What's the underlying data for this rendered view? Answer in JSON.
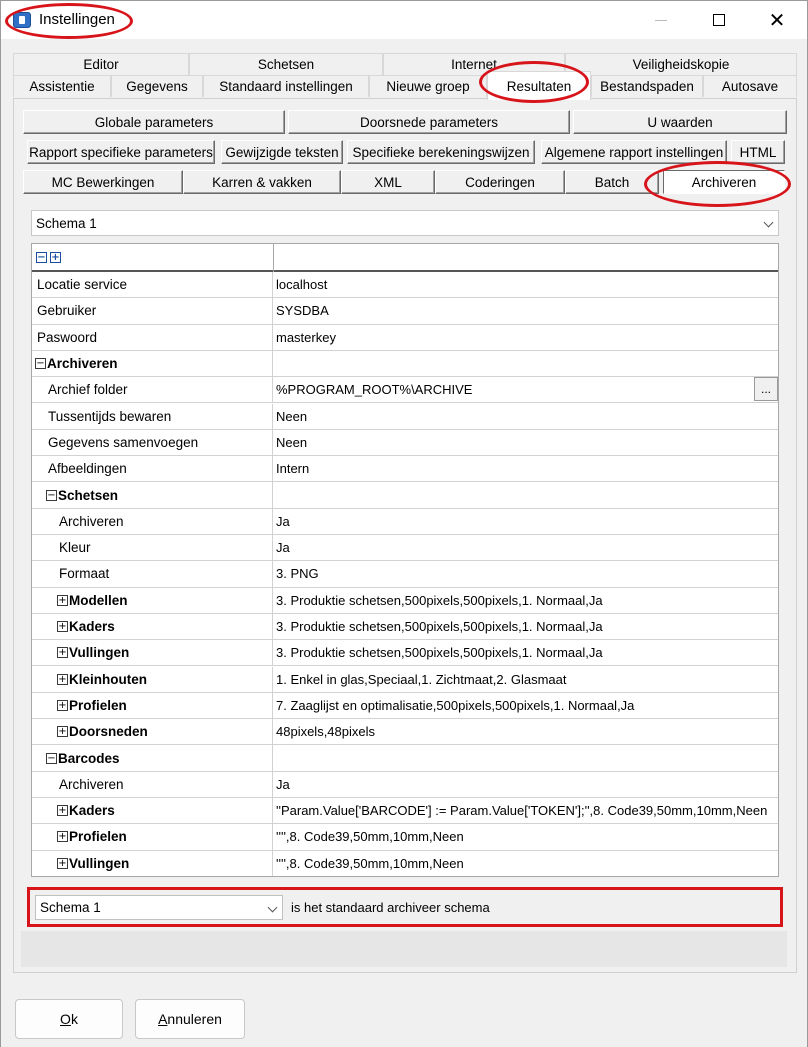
{
  "window": {
    "title": "Instellingen"
  },
  "tabs": {
    "back_row": [
      "Editor",
      "Schetsen",
      "Internet",
      "Veiligheidskopie"
    ],
    "front_row": [
      "Assistentie",
      "Gegevens",
      "Standaard instellingen",
      "Nieuwe groep",
      "Resultaten",
      "Bestandspaden",
      "Autosave"
    ],
    "active": "Resultaten"
  },
  "subtabs": {
    "row1": [
      "Globale parameters",
      "Doorsnede parameters",
      "U waarden"
    ],
    "row2": [
      "Rapport specifieke parameters",
      "Gewijzigde teksten",
      "Specifieke berekeningswijzen",
      "Algemene rapport instellingen",
      "HTML"
    ],
    "row3": [
      "MC Bewerkingen",
      "Karren & vakken",
      "XML",
      "Coderingen",
      "Batch",
      "Archiveren"
    ],
    "active": "Archiveren"
  },
  "schema_select": {
    "value": "Schema 1"
  },
  "grid": {
    "rows": [
      {
        "label": "Locatie service",
        "value": "localhost",
        "indent": 0,
        "expander": "",
        "bold": false
      },
      {
        "label": "Gebruiker",
        "value": "SYSDBA",
        "indent": 0,
        "expander": "",
        "bold": false
      },
      {
        "label": "Paswoord",
        "value": "masterkey",
        "indent": 0,
        "expander": "",
        "bold": false
      },
      {
        "label": "Archiveren",
        "value": "",
        "indent": 0,
        "expander": "−",
        "bold": true
      },
      {
        "label": "Archief folder",
        "value": "%PROGRAM_ROOT%\\ARCHIVE",
        "indent": 1,
        "expander": "",
        "bold": false,
        "ellipsis": "..."
      },
      {
        "label": "Tussentijds bewaren",
        "value": "Neen",
        "indent": 1,
        "expander": "",
        "bold": false
      },
      {
        "label": "Gegevens samenvoegen",
        "value": "Neen",
        "indent": 1,
        "expander": "",
        "bold": false
      },
      {
        "label": "Afbeeldingen",
        "value": "Intern",
        "indent": 1,
        "expander": "",
        "bold": false
      },
      {
        "label": "Schetsen",
        "value": "",
        "indent": 1,
        "expander": "−",
        "bold": true
      },
      {
        "label": "Archiveren",
        "value": "Ja",
        "indent": 2,
        "expander": "",
        "bold": false
      },
      {
        "label": "Kleur",
        "value": "Ja",
        "indent": 2,
        "expander": "",
        "bold": false
      },
      {
        "label": "Formaat",
        "value": "3. PNG",
        "indent": 2,
        "expander": "",
        "bold": false
      },
      {
        "label": "Modellen",
        "value": "3. Produktie schetsen,500pixels,500pixels,1. Normaal,Ja",
        "indent": 2,
        "expander": "+",
        "bold": true
      },
      {
        "label": "Kaders",
        "value": "3. Produktie schetsen,500pixels,500pixels,1. Normaal,Ja",
        "indent": 2,
        "expander": "+",
        "bold": true
      },
      {
        "label": "Vullingen",
        "value": "3. Produktie schetsen,500pixels,500pixels,1. Normaal,Ja",
        "indent": 2,
        "expander": "+",
        "bold": true
      },
      {
        "label": "Kleinhouten",
        "value": "1. Enkel in glas,Speciaal,1. Zichtmaat,2. Glasmaat",
        "indent": 2,
        "expander": "+",
        "bold": true
      },
      {
        "label": "Profielen",
        "value": "7. Zaaglijst en optimalisatie,500pixels,500pixels,1. Normaal,Ja",
        "indent": 2,
        "expander": "+",
        "bold": true
      },
      {
        "label": "Doorsneden",
        "value": "48pixels,48pixels",
        "indent": 2,
        "expander": "+",
        "bold": true
      },
      {
        "label": "Barcodes",
        "value": "",
        "indent": 1,
        "expander": "−",
        "bold": true
      },
      {
        "label": "Archiveren",
        "value": "Ja",
        "indent": 2,
        "expander": "",
        "bold": false
      },
      {
        "label": "Kaders",
        "value": "''Param.Value['BARCODE'] := Param.Value['TOKEN'];'',8. Code39,50mm,10mm,Neen",
        "indent": 2,
        "expander": "+",
        "bold": true
      },
      {
        "label": "Profielen",
        "value": "'''',8. Code39,50mm,10mm,Neen",
        "indent": 2,
        "expander": "+",
        "bold": true
      },
      {
        "label": "Vullingen",
        "value": "'''',8. Code39,50mm,10mm,Neen",
        "indent": 2,
        "expander": "+",
        "bold": true
      }
    ]
  },
  "default_schema": {
    "value": "Schema 1",
    "suffix": "is het standaard archiveer schema"
  },
  "footer": {
    "ok_label_mnemonic": "O",
    "ok_label_rest": "k",
    "cancel_label_mnemonic": "A",
    "cancel_label_rest": "nnuleren"
  },
  "colors": {
    "highlight": "#d8141b"
  }
}
